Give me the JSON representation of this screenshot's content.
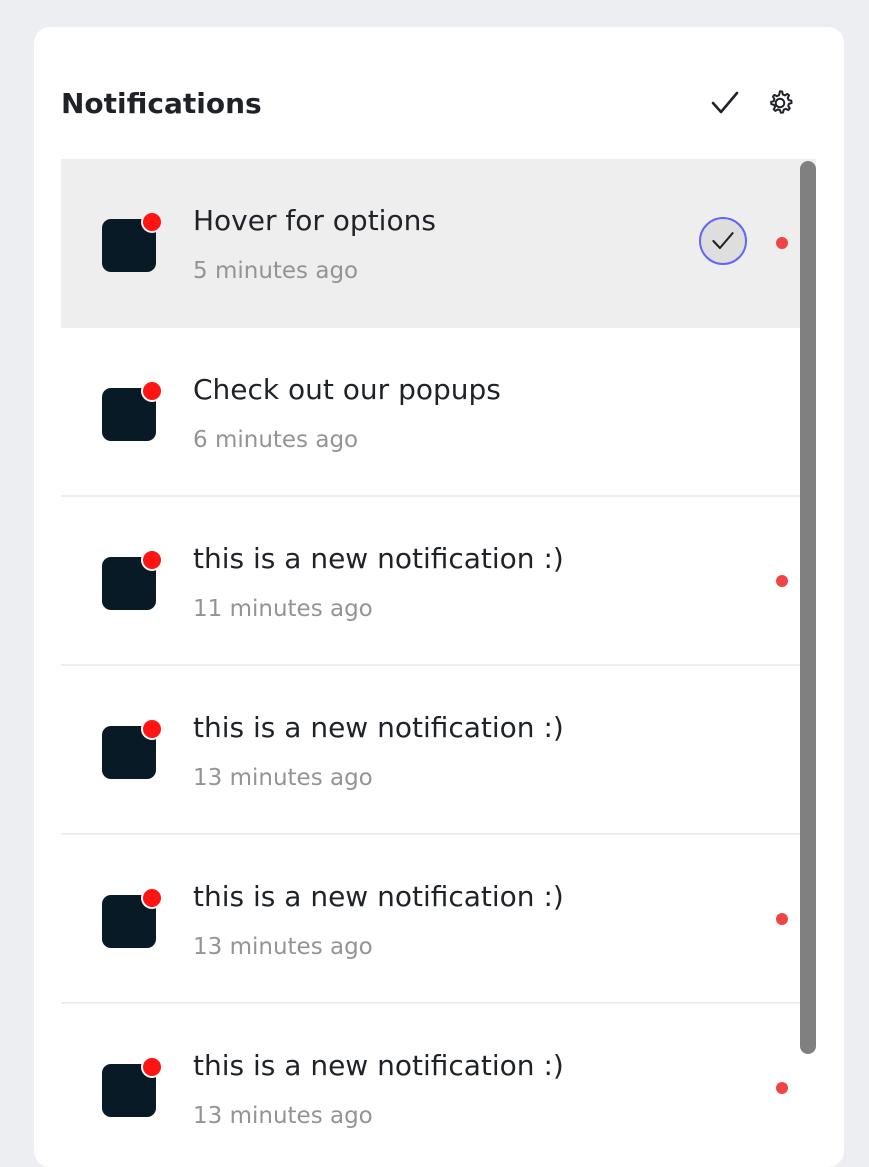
{
  "header": {
    "title": "Notifications",
    "mark_all_icon": "check-icon",
    "settings_icon": "gear-icon"
  },
  "notifications": [
    {
      "title": "Hover for options",
      "time": "5 minutes ago",
      "unread": true,
      "hovered": true
    },
    {
      "title": "Check out our popups",
      "time": "6 minutes ago",
      "unread": false,
      "hovered": false
    },
    {
      "title": "this is a new notification :)",
      "time": "11 minutes ago",
      "unread": true,
      "hovered": false
    },
    {
      "title": "this is a new notification :)",
      "time": "13 minutes ago",
      "unread": false,
      "hovered": false
    },
    {
      "title": "this is a new notification :)",
      "time": "13 minutes ago",
      "unread": true,
      "hovered": false
    },
    {
      "title": "this is a new notification :)",
      "time": "13 minutes ago",
      "unread": true,
      "hovered": false
    }
  ],
  "colors": {
    "avatar": "#081a26",
    "badge": "#ff1414",
    "unread_dot": "#ef4444",
    "hover_ring": "#6366f1",
    "hover_bg": "#eeeeee"
  }
}
